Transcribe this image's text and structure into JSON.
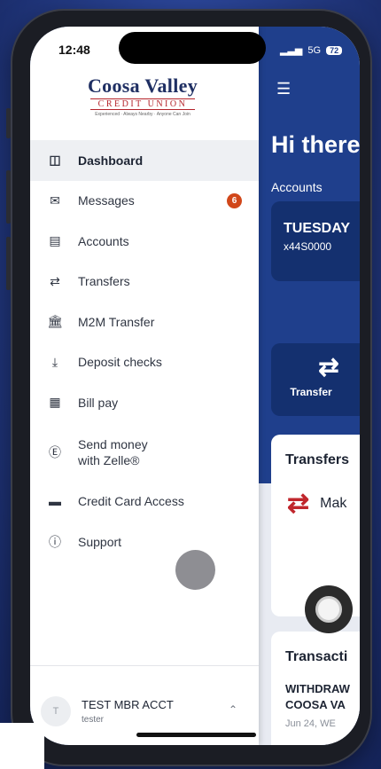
{
  "status": {
    "time": "12:48",
    "network": "5G",
    "battery": "72"
  },
  "logo": {
    "line1": "Coosa Valley",
    "line2": "CREDIT UNION",
    "tagline": "Experienced · Always Nearby · Anyone Can Join"
  },
  "menu": [
    {
      "label": "Dashboard",
      "icon": "dashboard-icon",
      "active": true
    },
    {
      "label": "Messages",
      "icon": "envelope-icon",
      "badge": "6"
    },
    {
      "label": "Accounts",
      "icon": "wallet-icon"
    },
    {
      "label": "Transfers",
      "icon": "transfer-arrows-icon"
    },
    {
      "label": "M2M Transfer",
      "icon": "bank-icon"
    },
    {
      "label": "Deposit checks",
      "icon": "deposit-icon"
    },
    {
      "label": "Bill pay",
      "icon": "bill-icon"
    },
    {
      "label": "Send money\nwith Zelle®",
      "icon": "zelle-icon"
    },
    {
      "label": "Credit Card Access",
      "icon": "credit-card-icon"
    },
    {
      "label": "Support",
      "icon": "help-icon"
    }
  ],
  "user": {
    "avatar": "T",
    "name": "TEST MBR ACCT",
    "sub": "tester"
  },
  "app": {
    "greeting": "Hi there",
    "accounts_label": "Accounts",
    "account_card": {
      "day": "TUESDAY",
      "number": "x44S0000"
    },
    "transfer_tile": "Transfer",
    "transfers_title": "Transfers",
    "make_label": "Mak",
    "transactions_title": "Transacti",
    "withdraw": "WITHDRAW\nCOOSA VA",
    "date": "Jun 24, WE"
  },
  "colors": {
    "navy": "#1f3f8c",
    "badge": "#d1471a",
    "accent_red": "#c0262c"
  }
}
